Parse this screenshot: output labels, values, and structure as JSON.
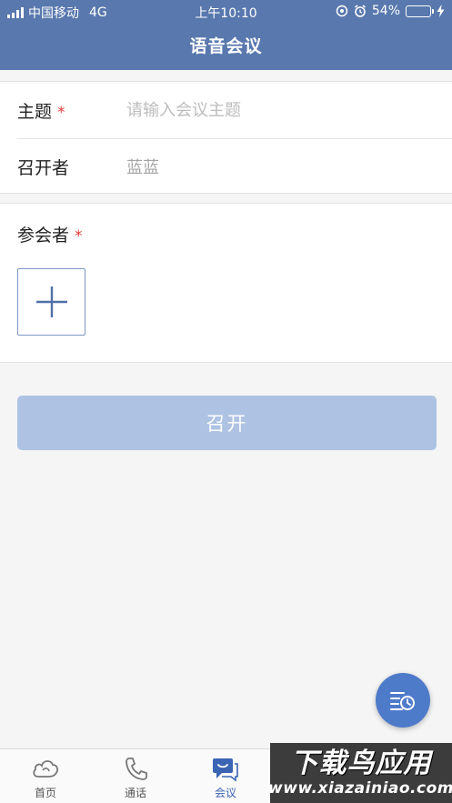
{
  "status_bar": {
    "carrier": "中国移动",
    "network": "4G",
    "time": "上午10:10",
    "battery_percent": "54%",
    "battery_level": 0.54
  },
  "header": {
    "title": "语音会议"
  },
  "form": {
    "topic": {
      "label": "主题",
      "required_mark": "*",
      "placeholder": "请输入会议主题",
      "value": ""
    },
    "host": {
      "label": "召开者",
      "value": "蓝蓝"
    },
    "participants": {
      "label": "参会者",
      "required_mark": "*"
    }
  },
  "submit": {
    "label": "召开"
  },
  "tabbar": {
    "items": [
      {
        "label": "首页",
        "icon": "cloud-icon"
      },
      {
        "label": "通话",
        "icon": "phone-icon"
      },
      {
        "label": "会议",
        "icon": "meeting-chat-icon",
        "active": true
      }
    ]
  },
  "watermark": {
    "line1": "下载鸟应用",
    "line2": "www.xiazainiao.com"
  },
  "colors": {
    "primary": "#5878ae",
    "accent": "#4e7bc9",
    "button_disabled": "#aec3e3",
    "required": "#e23b3b"
  }
}
